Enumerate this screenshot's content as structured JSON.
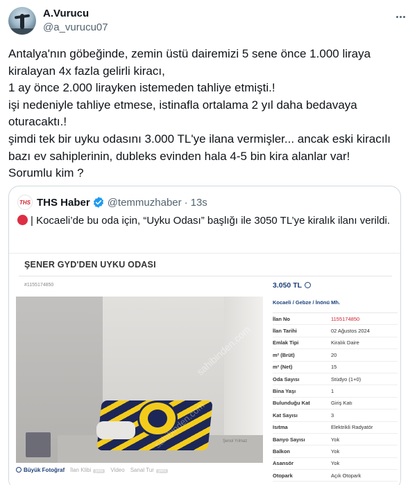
{
  "author": {
    "display_name": "A.Vurucu",
    "handle": "@a_vurucu07"
  },
  "tweet_lines": [
    "Antalya'nın göbeğinde, zemin üstü dairemizi 5 sene önce 1.000 liraya",
    "kiralayan 4x fazla gelirli kiracı,",
    "1 ay önce 2.000 lirayken istemeden tahliye etmişti.!",
    "işi nedeniyle tahliye etmese, istinafla ortalama 2 yıl daha bedavaya",
    "oturacaktı.!",
    "şimdi tek bir uyku odasını 3.000 TL'ye ilana vermişler... ancak eski kiracılı",
    "bazı ev sahiplerinin, dubleks evinden hala 4-5 bin kira alanlar var!",
    "Sorumlu kim ?"
  ],
  "quote": {
    "avatar_text": "THS",
    "display_name": "THS Haber",
    "handle": "@temmuzhaber",
    "separator": "·",
    "time": "13s",
    "text": "| Kocaeli’de bu oda için, “Uyku Odası” başlığı ile 3050 TL’ye kiralık ilanı verildi."
  },
  "listing": {
    "title": "ŞENER GYD'DEN UYKU ODASI",
    "listing_id": "#1155174850",
    "price": "3.050 TL",
    "location": "Kocaeli / Gebze / İnönü Mh.",
    "watermark": "sahibinden.com",
    "watermark2": "sahibinden.com",
    "photographer": "Şenol Yılmaz",
    "photo_tools": {
      "big_photo": "Büyük Fotoğraf",
      "video_clip": "İlan Klibi",
      "video": "Video",
      "virtual_tour": "Sanal Tur",
      "new_tag": "yeni"
    },
    "details": [
      {
        "key": "İlan No",
        "value": "1155174850"
      },
      {
        "key": "İlan Tarihi",
        "value": "02 Ağustos 2024"
      },
      {
        "key": "Emlak Tipi",
        "value": "Kiralık Daire"
      },
      {
        "key": "m² (Brüt)",
        "value": "20"
      },
      {
        "key": "m² (Net)",
        "value": "15"
      },
      {
        "key": "Oda Sayısı",
        "value": "Stüdyo (1+0)"
      },
      {
        "key": "Bina Yaşı",
        "value": "1"
      },
      {
        "key": "Bulunduğu Kat",
        "value": "Giriş Katı"
      },
      {
        "key": "Kat Sayısı",
        "value": "3"
      },
      {
        "key": "Isıtma",
        "value": "Elektrikli Radyatör"
      },
      {
        "key": "Banyo Sayısı",
        "value": "Yok"
      },
      {
        "key": "Balkon",
        "value": "Yok"
      },
      {
        "key": "Asansör",
        "value": "Yok"
      },
      {
        "key": "Otopark",
        "value": "Açık Otopark"
      }
    ]
  },
  "colors": {
    "text": "#0f1419",
    "muted": "#536471",
    "verified": "#1d9bf0",
    "listing_blue": "#1b3f7a",
    "listing_red": "#d0202f"
  }
}
